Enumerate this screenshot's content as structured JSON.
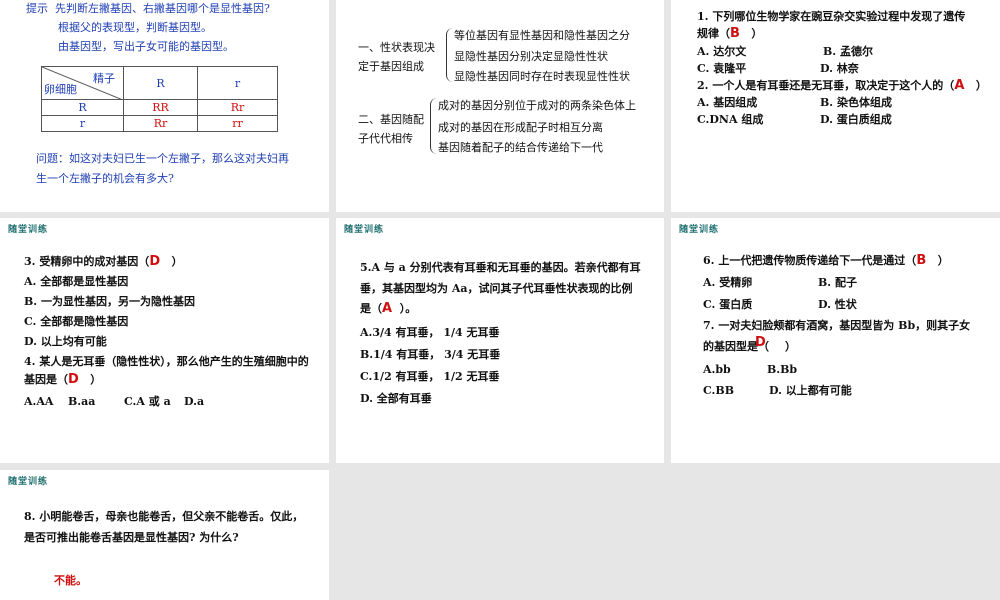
{
  "slide1": {
    "hint_label": "提示",
    "hint_text": "先判断左撇基因、右撇基因哪个是显性基因?",
    "line2": "根据父的表现型，判断基因型。",
    "line3": "由基因型，写出子女可能的基因型。",
    "table": {
      "corner_top": "精子",
      "corner_bottom": "卵细胞",
      "col_headers": [
        "R",
        "r"
      ],
      "rows": [
        {
          "header": "R",
          "cells": [
            "RR",
            "Rr"
          ]
        },
        {
          "header": "r",
          "cells": [
            "Rr",
            "rr"
          ]
        }
      ]
    },
    "question_line1": "问题：如这对夫妇已生一个左撇子，那么这对夫妇再",
    "question_line2": "生一个左撇子的机会有多大?"
  },
  "slide2": {
    "head1_line1": "一、性状表现决",
    "head1_line2": "定于基因组成",
    "items1": [
      "等位基因有显性基因和隐性基因之分",
      "显隐性基因分别决定显隐性性状",
      "显隐性基因同时存在时表现显性性状"
    ],
    "head2_line1": "二、基因随配",
    "head2_line2": "子代代相传",
    "items2": [
      "成对的基因分别位于成对的两条染色体上",
      "成对的基因在形成配子时相互分离",
      "基因随着配子的结合传递给下一代"
    ]
  },
  "slide3": {
    "q1_line1": "1. 下列哪位生物学家在豌豆杂交实验过程中发现了遗传",
    "q1_line2_pre": "规律（",
    "q1_answer": "B",
    "q1_line2_post": "）",
    "q1_options": [
      "A. 达尔文",
      "B. 孟德尔",
      "C. 袁隆平",
      "D. 林奈"
    ],
    "q2_line1_pre": "2. 一个人是有耳垂还是无耳垂，取决定于这个人的（",
    "q2_answer": "A",
    "q2_line1_post": "）",
    "q2_options": [
      "A. 基因组成",
      "B. 染色体组成",
      "C.DNA 组成",
      "D. 蛋白质组成"
    ]
  },
  "slide4": {
    "tag": "随堂训练",
    "q3_pre": "3. 受精卵中的成对基因（",
    "q3_answer": "D",
    "q3_post": "）",
    "q3_options": [
      "A. 全部都是显性基因",
      "B. 一为显性基因，另一为隐性基因",
      "C. 全部都是隐性基因",
      "D. 以上均有可能"
    ],
    "q4_line1": "4. 某人是无耳垂（隐性性状），那么他产生的生殖细胞中的",
    "q4_line2_pre": "基因是（",
    "q4_answer": "D",
    "q4_line2_post": "）",
    "q4_options": [
      "A.AA",
      "B.aa",
      "C.A 或 a",
      "D.a"
    ]
  },
  "slide5": {
    "tag": "随堂训练",
    "q5_line1": "5.A 与 a 分别代表有耳垂和无耳垂的基因。若亲代都有耳",
    "q5_line2": "垂，其基因型均为 Aa，试问其子代耳垂性状表现的比例",
    "q5_line3_pre": "是（",
    "q5_answer": "A",
    "q5_line3_post": "）。",
    "q5_options": [
      "A.3/4 有耳垂，  1/4 无耳垂",
      "B.1/4 有耳垂，  3/4 无耳垂",
      "C.1/2 有耳垂，  1/2 无耳垂",
      "D. 全部有耳垂"
    ]
  },
  "slide6": {
    "tag": "随堂训练",
    "q6_pre": "6. 上一代把遗传物质传递给下一代是通过（",
    "q6_answer": "B",
    "q6_post": "）",
    "q6_options": [
      "A. 受精卵",
      "B. 配子",
      "C. 蛋白质",
      "D. 性状"
    ],
    "q7_line1": "7. 一对夫妇脸颊都有酒窝，基因型皆为 Bb，则其子女",
    "q7_line2_pre": "的基因型是（",
    "q7_answer": "D",
    "q7_line2_post": "）",
    "q7_options": [
      "A.bb",
      "B.Bb",
      "C.BB",
      "D. 以上都有可能"
    ]
  },
  "slide7": {
    "tag": "随堂训练",
    "q8_line1": "8. 小明能卷舌，母亲也能卷舌，但父亲不能卷舌。仅此，",
    "q8_line2": "是否可推出能卷舌基因是显性基因? 为什么?",
    "answer": "不能。"
  }
}
